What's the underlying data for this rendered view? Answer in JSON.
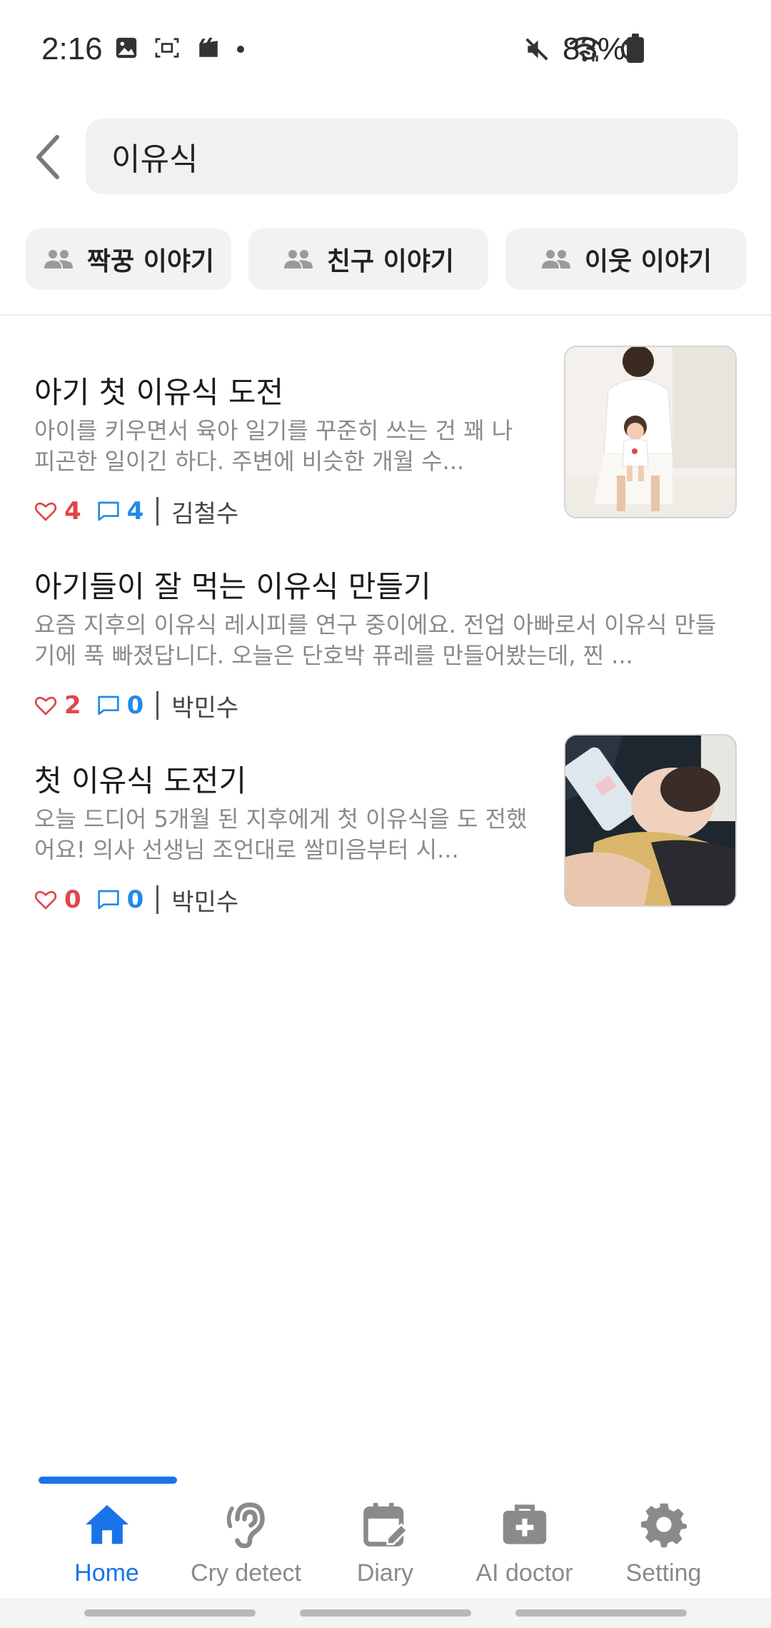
{
  "status_bar": {
    "time": "2:16",
    "battery": "83%",
    "left_icons": [
      "image-icon",
      "screen-capture-icon",
      "clapper-icon",
      "dot-icon"
    ],
    "right_icons": [
      "mute-icon",
      "wifi-icon",
      "do-not-disturb-icon",
      "battery-icon"
    ]
  },
  "search": {
    "query": "이유식"
  },
  "chips": [
    {
      "label": "짝꿍 이야기",
      "icon": "people-icon"
    },
    {
      "label": "친구 이야기",
      "icon": "people-icon"
    },
    {
      "label": "이웃 이야기",
      "icon": "people-icon"
    }
  ],
  "posts": [
    {
      "title": "아기 첫 이유식 도전",
      "excerpt": "아이를 키우면서 육아 일기를 꾸준히 쓰는 건 꽤 나 피곤한 일이긴 하다. 주변에 비슷한 개월 수...",
      "likes": "4",
      "comments": "4",
      "author": "김철수",
      "has_image": true
    },
    {
      "title": "아기들이 잘 먹는 이유식 만들기",
      "excerpt": "요즘 지후의 이유식 레시피를 연구 중이에요. 전업 아빠로서 이유식 만들기에 푹 빠졌답니다. 오늘은 단호박 퓨레를 만들어봤는데, 찐 ...",
      "likes": "2",
      "comments": "0",
      "author": "박민수",
      "has_image": false
    },
    {
      "title": "첫 이유식 도전기",
      "excerpt": "오늘 드디어 5개월 된 지후에게 첫 이유식을 도 전했어요! 의사 선생님 조언대로 쌀미음부터 시...",
      "likes": "0",
      "comments": "0",
      "author": "박민수",
      "has_image": true
    }
  ],
  "bottom_nav": [
    {
      "label": "Home",
      "icon": "home-icon",
      "active": true
    },
    {
      "label": "Cry detect",
      "icon": "ear-icon",
      "active": false
    },
    {
      "label": "Diary",
      "icon": "calendar-edit-icon",
      "active": false
    },
    {
      "label": "AI doctor",
      "icon": "medical-kit-icon",
      "active": false
    },
    {
      "label": "Setting",
      "icon": "gear-icon",
      "active": false
    }
  ],
  "colors": {
    "accent": "#1a73e8",
    "like": "#e0464a",
    "comment": "#1f8be8",
    "muted_text": "#8a8a8a"
  }
}
